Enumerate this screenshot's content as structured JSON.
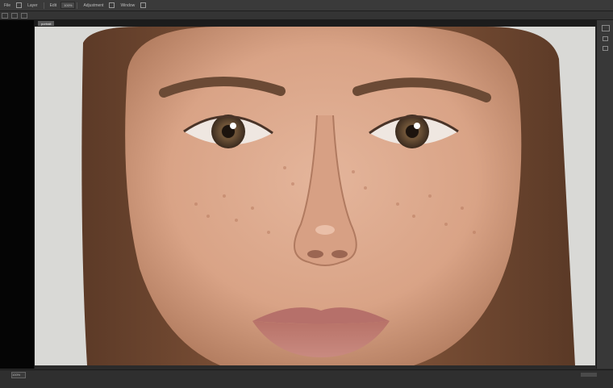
{
  "menubar": {
    "items": [
      "File",
      "Layer",
      "Edit",
      "Adjustment",
      "Window"
    ],
    "field_value": "100%"
  },
  "document": {
    "tab_label": "portrait"
  },
  "canvas": {
    "image_subject": "portrait-photo",
    "bg_color": "#d9d9d6",
    "skin_color": "#d9a386",
    "hair_color": "#6e4630"
  },
  "status": {
    "zoom": "100%"
  }
}
